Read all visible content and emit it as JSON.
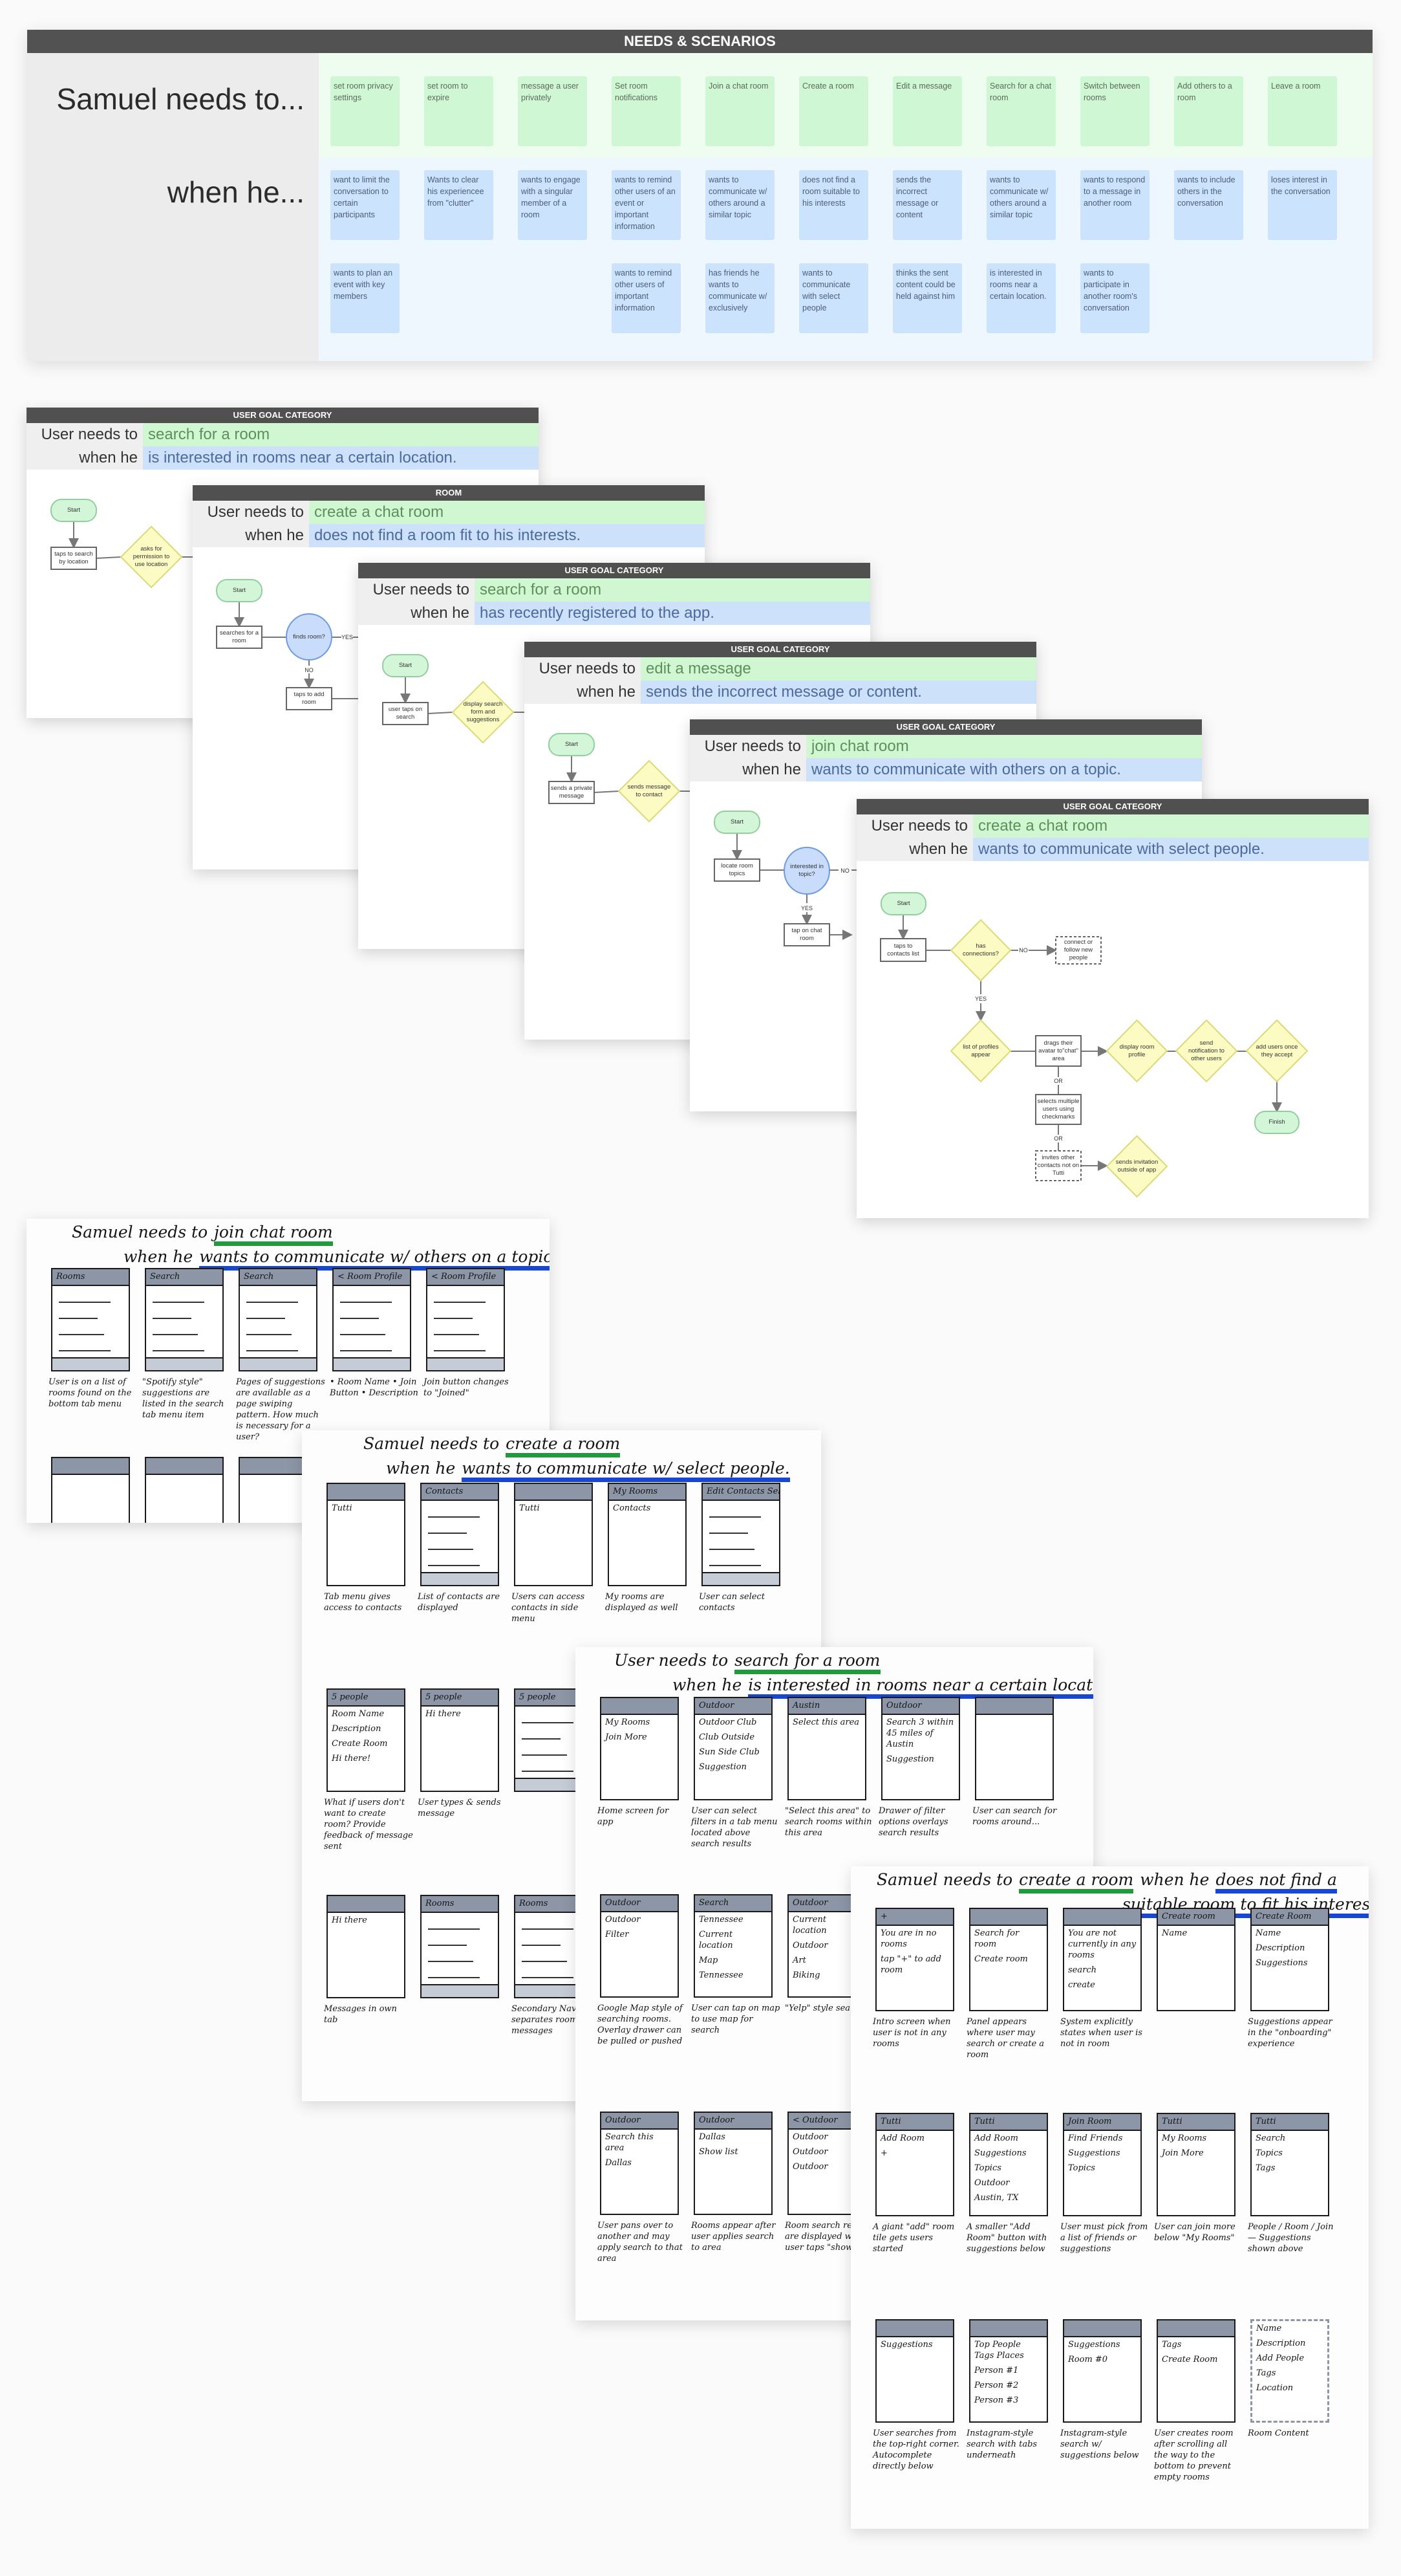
{
  "needs_scenarios": {
    "title": "NEEDS & SCENARIOS",
    "needs_label": "Samuel needs to...",
    "when_label": "when he...",
    "needs": [
      "set room privacy settings",
      "set room to expire",
      "message a user privately",
      "Set room notifications",
      "Join a chat room",
      "Create a room",
      "Edit a message",
      "Search for a chat room",
      "Switch between rooms",
      "Add others to a room",
      "Leave a room"
    ],
    "when_row1": [
      "want to limit the conversation to certain participants",
      "Wants to clear his experiencee from \"clutter\"",
      "wants to engage with a singular member of a room",
      "wants to remind other users of an event or important information",
      "wants to communicate w/ others around a similar topic",
      "does not find a room suitable to his interests",
      "sends the incorrect message or content",
      "wants to communicate w/ others around a similar topic",
      "wants to respond to a message in another room",
      "wants to include others in the conversation",
      "loses interest in the conversation"
    ],
    "when_row2": [
      "wants to plan an event  with key members",
      null,
      null,
      "wants to remind other users of important information",
      "has friends he wants to communicate w/ exclusively",
      "wants to communicate with select people",
      "thinks the sent content could be held against him",
      "is interested in rooms near a certain location.",
      "wants to participate in another room's conversation",
      null,
      null
    ]
  },
  "flows": [
    {
      "category": "USER GOAL CATEGORY",
      "needs_label": "User needs to",
      "need": "search for a room",
      "when_label": "when he",
      "when": "is interested in rooms near a certain location.",
      "nodes": [
        "Start",
        "taps to search by location",
        "asks for permission to use location"
      ],
      "labels": []
    },
    {
      "category": "ROOM",
      "needs_label": "User needs to",
      "need": "create a chat room",
      "when_label": "when he",
      "when": "does not find a room fit to his interests.",
      "nodes": [
        "Start",
        "searches for a room",
        "finds room?",
        "taps to add room"
      ],
      "labels": [
        "YES",
        "NO"
      ]
    },
    {
      "category": "USER GOAL CATEGORY",
      "needs_label": "User needs to",
      "need": "search for a room",
      "when_label": "when he",
      "when": "has recently registered to the app.",
      "nodes": [
        "Start",
        "user taps on search",
        "display search form and suggestions"
      ],
      "labels": []
    },
    {
      "category": "USER GOAL CATEGORY",
      "needs_label": "User needs to",
      "need": "edit a message",
      "when_label": "when he",
      "when": "sends the incorrect message or content.",
      "nodes": [
        "Start",
        "sends a private message",
        "sends message to contact"
      ],
      "labels": []
    },
    {
      "category": "USER GOAL CATEGORY",
      "needs_label": "User needs to",
      "need": "join chat room",
      "when_label": "when he",
      "when": "wants to communicate with others on a topic.",
      "nodes": [
        "Start",
        "locate room topics",
        "interested in topic?",
        "tap on chat room"
      ],
      "labels": [
        "NO",
        "YES"
      ]
    },
    {
      "category": "USER GOAL CATEGORY",
      "needs_label": "User needs to",
      "need": "create a chat room",
      "when_label": "when he",
      "when": "wants to communicate with select people.",
      "nodes": [
        "Start",
        "taps to contacts list",
        "has connections?",
        "connect or follow new people",
        "list of profiles appear",
        "drags their avatar to\"chat\" area",
        "display room profile",
        "send notification to other users",
        "add users once they accept",
        "Finish",
        "selects multiple users using checkmarks",
        "invites other contacts not on Tutti",
        "sends invitation outside of app"
      ],
      "labels": [
        "NO",
        "YES",
        "OR",
        "OR"
      ]
    }
  ],
  "sketches": [
    {
      "title": [
        [
          {
            "text": "Samuel needs to"
          },
          {
            "text": "join chat room",
            "highlight": "green"
          }
        ],
        [
          {
            "text": "when he"
          },
          {
            "text": "wants to communicate w/ others on a topic",
            "highlight": "blue"
          }
        ]
      ],
      "rows": [
        [
          {
            "header": "Rooms",
            "caption": "User is on a list of rooms found on the bottom tab menu"
          },
          {
            "header": "Search",
            "caption": "\"Spotify style\" suggestions are listed in the search tab menu item"
          },
          {
            "header": "Search",
            "caption": "Pages of suggestions are available as a page swiping pattern. How much is necessary for a user?"
          },
          {
            "header": "< Room Profile",
            "caption": "• Room Name • Join Button • Description"
          },
          {
            "header": "< Room Profile",
            "caption": "Join button changes to \"Joined\""
          }
        ],
        [
          {
            "header": "",
            "caption": ""
          },
          {
            "header": "",
            "caption": ""
          },
          {
            "header": "",
            "caption": ""
          }
        ]
      ]
    },
    {
      "title": [
        [
          {
            "text": "Samuel needs to"
          },
          {
            "text": "create a room",
            "highlight": "green"
          }
        ],
        [
          {
            "text": "when he"
          },
          {
            "text": "wants to communicate w/ select people.",
            "highlight": "blue"
          }
        ]
      ],
      "rows": [
        [
          {
            "header": "",
            "caption": "Tab menu gives access to contacts",
            "items": [
              "Tutti"
            ]
          },
          {
            "header": "Contacts",
            "caption": "List of contacts are displayed"
          },
          {
            "header": "",
            "caption": "Users can access contacts in side menu",
            "items": [
              "Tutti"
            ]
          },
          {
            "header": "My Rooms",
            "caption": "My rooms are displayed as well",
            "items": [
              "Contacts"
            ]
          },
          {
            "header": "Edit Contacts  Select",
            "caption": "User can select contacts"
          }
        ],
        [
          {
            "header": "5 people",
            "caption": "What if users don't want to create room? Provide feedback of message sent",
            "items": [
              "Room Name",
              "Description",
              "Create Room",
              "Hi there!"
            ]
          },
          {
            "header": "5 people",
            "caption": "User types & sends message",
            "items": [
              "Hi there"
            ]
          },
          {
            "header": "5 people",
            "caption": ""
          }
        ],
        [
          {
            "header": "",
            "caption": "Messages in own tab",
            "items": [
              "Hi there"
            ]
          },
          {
            "header": "Rooms",
            "caption": ""
          },
          {
            "header": "Rooms",
            "caption": "Secondary Nav separates rooms & messages"
          }
        ]
      ]
    },
    {
      "title": [
        [
          {
            "text": "User needs to"
          },
          {
            "text": "search for a room",
            "highlight": "green"
          }
        ],
        [
          {
            "text": "when he"
          },
          {
            "text": "is interested in rooms near a certain location",
            "highlight": "blue"
          }
        ]
      ],
      "rows": [
        [
          {
            "header": "",
            "caption": "Home screen for app",
            "items": [
              "My Rooms",
              "Join More"
            ]
          },
          {
            "header": "Outdoor",
            "caption": "User can select filters in a tab menu located above search results",
            "items": [
              "Outdoor Club",
              "Club Outside",
              "Sun Side Club",
              "Suggestion"
            ]
          },
          {
            "header": "Austin",
            "caption": "\"Select this area\" to search rooms within this area",
            "items": [
              "Select this area"
            ]
          },
          {
            "header": "Outdoor",
            "caption": "Drawer of filter options overlays search results",
            "items": [
              "Search 3 within 45 miles of Austin",
              "Suggestion"
            ]
          },
          {
            "header": "",
            "caption": "User can search for rooms around..."
          }
        ],
        [
          {
            "header": "Outdoor",
            "caption": "Google Map style of searching rooms. Overlay drawer can be pulled or pushed",
            "items": [
              "Outdoor",
              "Filter"
            ]
          },
          {
            "header": "Search",
            "caption": "User can tap on map to use map for search",
            "items": [
              "Tennessee",
              "Current location",
              "Map",
              "Tennessee"
            ]
          },
          {
            "header": "Outdoor",
            "caption": "\"Yelp\" style search",
            "items": [
              "Current location",
              "Outdoor",
              "Art",
              "Biking"
            ]
          }
        ],
        [
          {
            "header": "Outdoor",
            "caption": "User pans over to another and may apply search to that area",
            "items": [
              "Search this area",
              "Dallas"
            ]
          },
          {
            "header": "Outdoor",
            "caption": "Rooms appear after user applies search to area",
            "items": [
              "Dallas",
              "Show list"
            ]
          },
          {
            "header": "< Outdoor",
            "caption": "Room search results are displayed when user taps \"show list\"",
            "items": [
              "Outdoor",
              "Outdoor",
              "Outdoor"
            ]
          }
        ]
      ]
    },
    {
      "title": [
        [
          {
            "text": "Samuel needs to"
          },
          {
            "text": "create a room",
            "highlight": "green"
          },
          {
            "text": "when he"
          },
          {
            "text": "does not find a",
            "highlight": "blue"
          }
        ],
        [
          {
            "text": "suitable room to fit his interests",
            "highlight": "blue"
          }
        ]
      ],
      "rows": [
        [
          {
            "header": "+",
            "caption": "Intro screen when user is not in any rooms",
            "items": [
              "You are in no rooms",
              "tap \"+\" to add room"
            ]
          },
          {
            "header": "",
            "caption": "Panel appears where user may search or create a room",
            "items": [
              "Search for room",
              "Create room"
            ]
          },
          {
            "header": "",
            "caption": "System explicitly states when user is not in room",
            "items": [
              "You are not currently in any rooms",
              "search",
              "create"
            ]
          },
          {
            "header": "Create room",
            "caption": "",
            "items": [
              "Name"
            ]
          },
          {
            "header": "Create Room",
            "caption": "Suggestions appear in the \"onboarding\" experience",
            "items": [
              "Name",
              "Description",
              "Suggestions"
            ]
          }
        ],
        [
          {
            "header": "Tutti",
            "caption": "A giant \"add\" room tile gets users started",
            "items": [
              "Add Room",
              "+"
            ]
          },
          {
            "header": "Tutti",
            "caption": "A smaller \"Add Room\" button with suggestions below",
            "items": [
              "Add Room",
              "Suggestions",
              "Topics",
              "Outdoor",
              "Austin, TX"
            ]
          },
          {
            "header": "Join Room",
            "caption": "User must pick from a list of friends or suggestions",
            "items": [
              "Find Friends",
              "Suggestions",
              "Topics"
            ]
          },
          {
            "header": "Tutti",
            "caption": "User can join more below \"My Rooms\"",
            "items": [
              "My Rooms",
              "Join More"
            ]
          },
          {
            "header": "Tutti",
            "caption": "People / Room / Join — Suggestions shown above",
            "items": [
              "Search",
              "Topics",
              "Tags"
            ]
          }
        ],
        [
          {
            "header": "",
            "caption": "User searches from the top-right corner. Autocomplete directly below",
            "items": [
              "Suggestions"
            ]
          },
          {
            "header": "",
            "caption": "Instagram-style search with tabs underneath",
            "items": [
              "Top  People  Tags  Places",
              "Person #1",
              "Person #2",
              "Person #3"
            ]
          },
          {
            "header": "",
            "caption": "Instagram-style search w/ suggestions below",
            "items": [
              "Suggestions",
              "Room #0"
            ]
          },
          {
            "header": "",
            "caption": "User creates room after scrolling all the way to the bottom to prevent empty rooms",
            "items": [
              "Tags",
              "Create Room"
            ]
          },
          {
            "header": "",
            "caption": "Room Content",
            "items": [
              "Name",
              "Description",
              "Add People",
              "Tags",
              "Location"
            ]
          }
        ]
      ]
    }
  ]
}
